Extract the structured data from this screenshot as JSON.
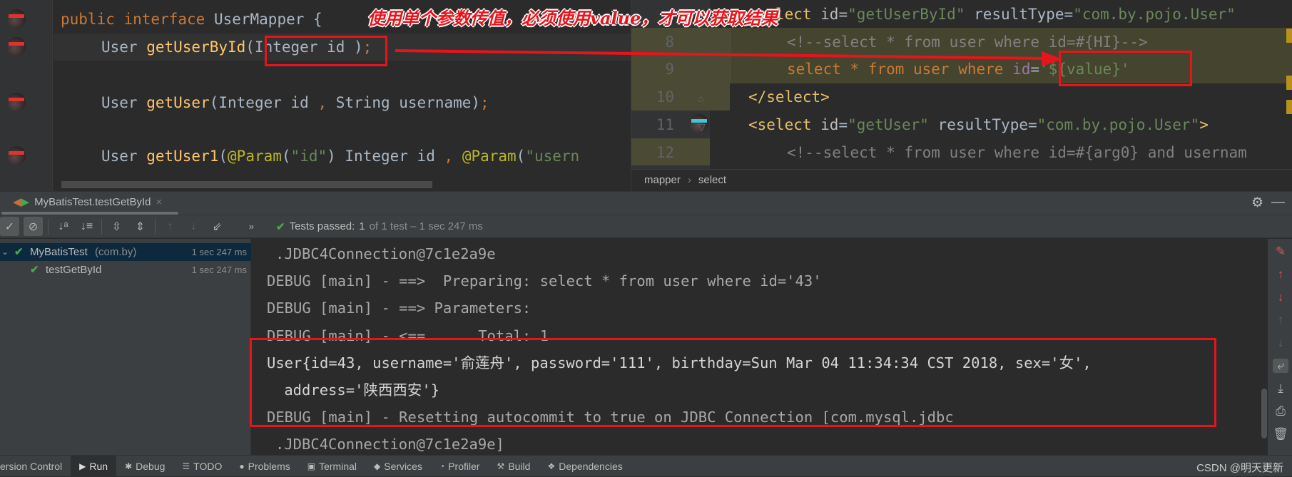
{
  "left_editor": {
    "lines": [
      {
        "parts": [
          [
            "kw",
            "public interface "
          ],
          [
            "",
            "UserMapper {"
          ]
        ]
      },
      {
        "parts": [
          [
            "",
            "User "
          ],
          [
            "fn",
            "getUserById"
          ],
          [
            "",
            "(Integer id )"
          ],
          [
            "kw",
            ";"
          ]
        ]
      },
      {
        "parts": [
          [
            "",
            "User "
          ],
          [
            "fn",
            "getUser"
          ],
          [
            "",
            "(Integer id "
          ],
          [
            "kw",
            ","
          ],
          [
            "",
            " String username)"
          ],
          [
            "kw",
            ";"
          ]
        ]
      },
      {
        "parts": [
          [
            "",
            "User "
          ],
          [
            "fn",
            "getUser1"
          ],
          [
            "",
            "("
          ],
          [
            "ann",
            "@Param"
          ],
          [
            "",
            "("
          ],
          [
            "str",
            "\"id\""
          ],
          [
            "",
            ") Integer id "
          ],
          [
            "kw",
            ","
          ],
          [
            "",
            " "
          ],
          [
            "ann",
            "@Param"
          ],
          [
            "",
            "("
          ],
          [
            "str",
            "\"usern"
          ]
        ]
      }
    ]
  },
  "right_editor": {
    "lines": [
      {
        "num": "",
        "parts": [
          [
            "tag",
            "<select "
          ],
          [
            "attr",
            "id"
          ],
          [
            "",
            "="
          ],
          [
            "str",
            "\"getUserById\""
          ],
          [
            "",
            " resultType="
          ],
          [
            "str",
            "\"com.by.pojo.User\""
          ]
        ]
      },
      {
        "num": "8",
        "parts": [
          [
            "cm",
            "<!--select * from user where id=#{HI}-->"
          ]
        ]
      },
      {
        "num": "9",
        "parts": [
          [
            "kw",
            "select * from user where "
          ],
          [
            "ph",
            "id"
          ],
          [
            "",
            "="
          ],
          [
            "str",
            "'${value}'"
          ]
        ]
      },
      {
        "num": "10",
        "parts": [
          [
            "tag",
            "</select>"
          ]
        ]
      },
      {
        "num": "11",
        "parts": [
          [
            "tag",
            "<select "
          ],
          [
            "attr",
            "id"
          ],
          [
            "",
            "="
          ],
          [
            "str",
            "\"getUser\""
          ],
          [
            "",
            " resultType="
          ],
          [
            "str",
            "\"com.by.pojo.User\""
          ],
          [
            "tag",
            ">"
          ]
        ]
      },
      {
        "num": "12",
        "parts": [
          [
            "cm",
            "<!--select * from user where id=#{arg0} and usernam"
          ]
        ]
      }
    ],
    "breadcrumb": [
      "mapper",
      "select"
    ]
  },
  "annotation": {
    "text": "使用单个参数传值，必须使用value，才可以获取结果",
    "color": "#e8141c"
  },
  "run_panel": {
    "tab_label": "MyBatisTest.testGetById",
    "status": {
      "prefix": "Tests passed:",
      "passed": "1",
      "rest": "of 1 test – 1 sec 247 ms"
    },
    "tree": [
      {
        "label": "MyBatisTest",
        "pkg": "(com.by)",
        "time": "1 sec 247 ms"
      },
      {
        "label": "testGetById",
        "time": "1 sec 247 ms"
      }
    ],
    "console": [
      {
        "text": ".JDBC4Connection@7c1e2a9e",
        "type": "log"
      },
      {
        "text": "DEBUG [main] - ==>  Preparing: select * from user where id='43'",
        "type": "log"
      },
      {
        "text": "DEBUG [main] - ==> Parameters: ",
        "type": "log"
      },
      {
        "text": "DEBUG [main] - <==      Total: 1",
        "type": "log"
      },
      {
        "text": "User{id=43, username='俞莲舟', password='111', birthday=Sun Mar 04 11:34:34 CST 2018, sex='女',",
        "type": "out"
      },
      {
        "text": " address='陕西西安'}",
        "type": "out"
      },
      {
        "text": "DEBUG [main] - Resetting autocommit to true on JDBC Connection [com.mysql.jdbc",
        "type": "log"
      },
      {
        "text": ".JDBC4Connection@7c1e2a9e]",
        "type": "log"
      }
    ]
  },
  "bottom_bar": {
    "items": [
      {
        "label": "ersion Control",
        "icon": "version-control-icon"
      },
      {
        "label": "Run",
        "icon": "run-icon",
        "active": true
      },
      {
        "label": "Debug",
        "icon": "bug-icon"
      },
      {
        "label": "TODO",
        "icon": "list-icon"
      },
      {
        "label": "Problems",
        "icon": "warning-icon"
      },
      {
        "label": "Terminal",
        "icon": "terminal-icon"
      },
      {
        "label": "Services",
        "icon": "services-icon"
      },
      {
        "label": "Profiler",
        "icon": "profiler-icon"
      },
      {
        "label": "Build",
        "icon": "hammer-icon"
      },
      {
        "label": "Dependencies",
        "icon": "dependencies-icon"
      }
    ],
    "watermark": "CSDN @明天更新"
  }
}
